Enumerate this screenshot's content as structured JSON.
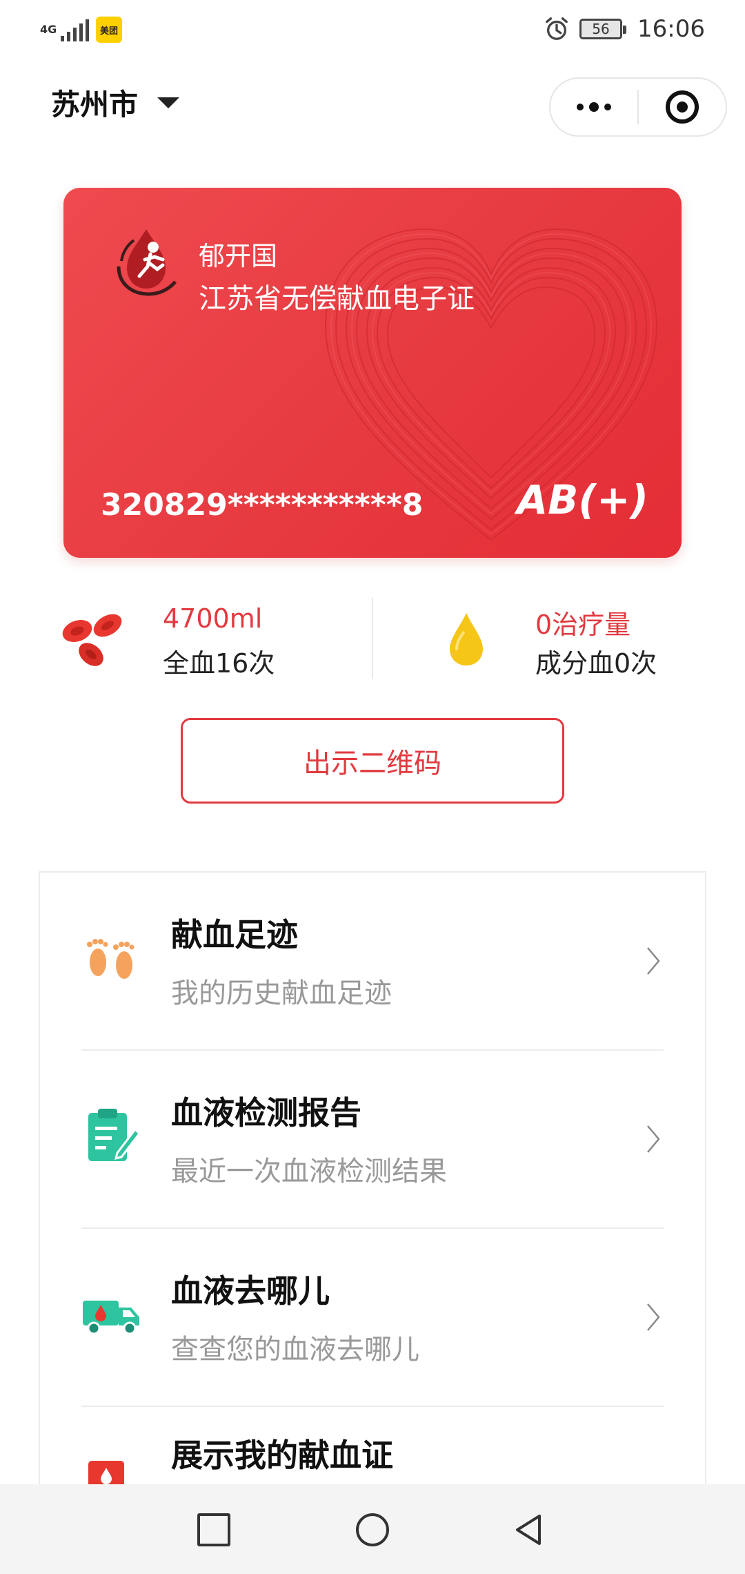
{
  "status_bar": {
    "network": "4G",
    "app_icon": "美团",
    "battery": "56",
    "time": "16:06",
    "icons": [
      "signal-icon",
      "meituan-app-icon",
      "alarm-icon",
      "battery-icon"
    ]
  },
  "header": {
    "city": "苏州市",
    "icons": [
      "chevron-down-icon",
      "more-icon",
      "close-target-icon"
    ]
  },
  "card": {
    "name": "郁开国",
    "title": "江苏省无偿献血电子证",
    "id_number": "320829***********8",
    "blood_type": "AB(+)"
  },
  "stats": {
    "whole_blood_value": "4700ml",
    "whole_blood_label": "全血16次",
    "component_value": "0治疗量",
    "component_label": "成分血0次"
  },
  "qr_button": "出示二维码",
  "menu": [
    {
      "title": "献血足迹",
      "subtitle": "我的历史献血足迹",
      "icon": "footprints-icon"
    },
    {
      "title": "血液检测报告",
      "subtitle": "最近一次血液检测结果",
      "icon": "report-clipboard-icon"
    },
    {
      "title": "血液去哪儿",
      "subtitle": "查查您的血液去哪儿",
      "icon": "blood-truck-icon"
    },
    {
      "title": "展示我的献血证",
      "subtitle": "",
      "icon": "certificate-icon"
    }
  ],
  "colors": {
    "brand_red": "#e13a3f",
    "card_red": "#e63a40",
    "drop_yellow": "#f5c518",
    "icon_teal": "#2ec4a0",
    "icon_orange": "#f5a25d"
  }
}
